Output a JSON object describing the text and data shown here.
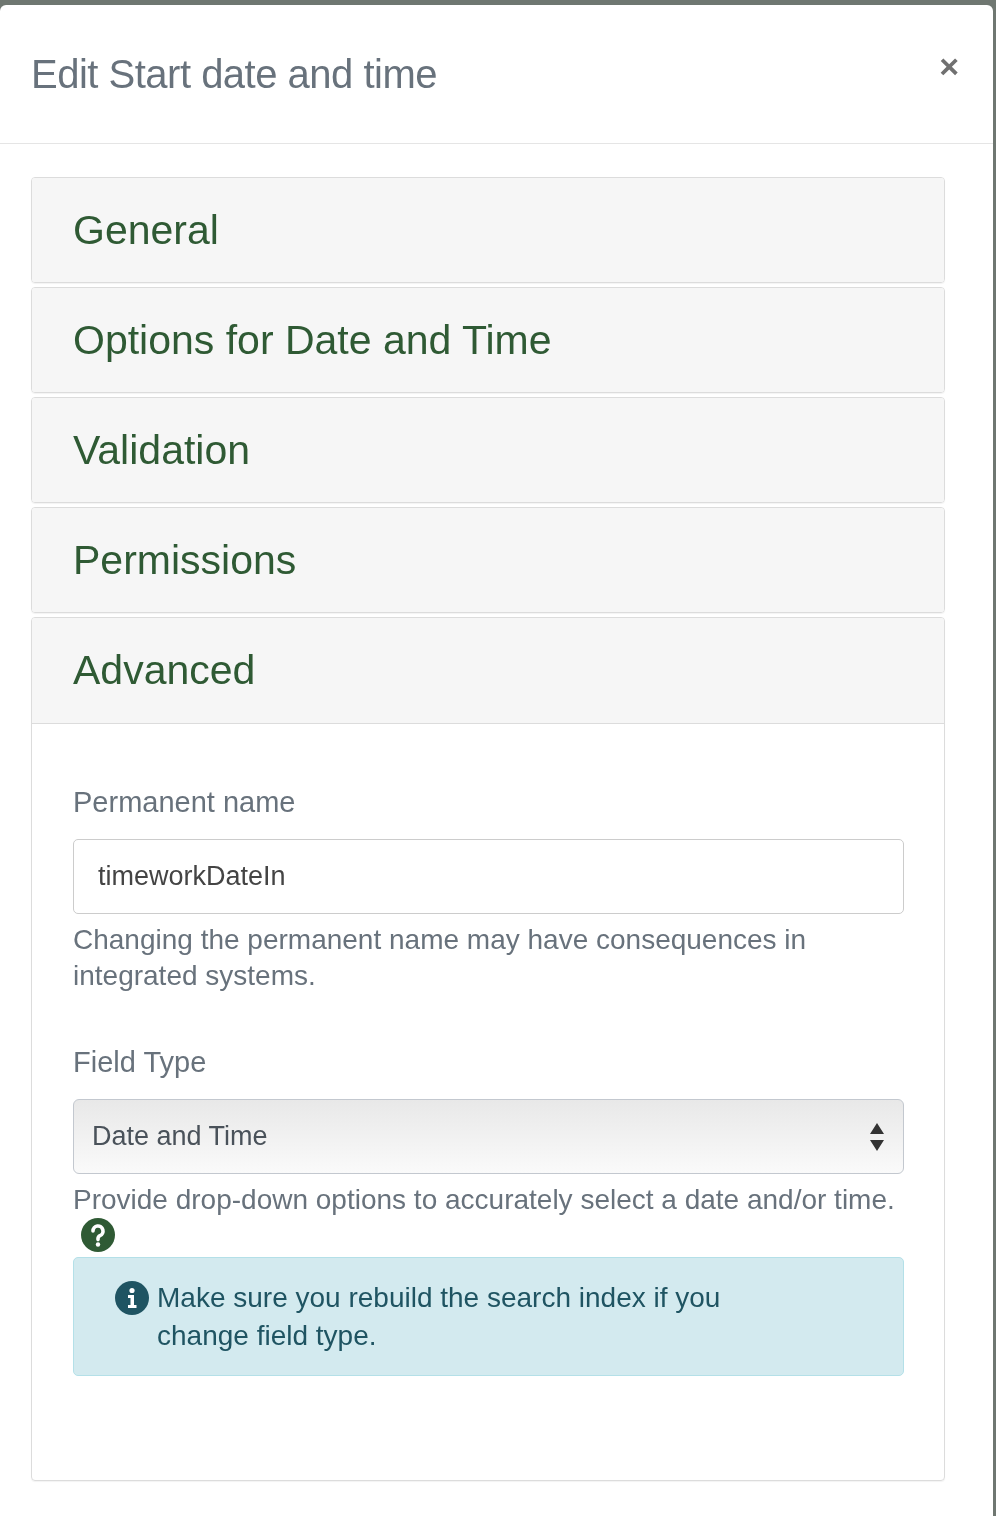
{
  "modal": {
    "title": "Edit Start date and time",
    "close": "×"
  },
  "sections": [
    {
      "title": "General",
      "expanded": false
    },
    {
      "title": "Options for Date and Time",
      "expanded": false
    },
    {
      "title": "Validation",
      "expanded": false
    },
    {
      "title": "Permissions",
      "expanded": false
    },
    {
      "title": "Advanced",
      "expanded": true,
      "fields": [
        {
          "kind": "text",
          "label": "Permanent name",
          "value": "timeworkDateIn",
          "help": "Changing the permanent name may have consequences in integrated systems.",
          "help_icon": false
        },
        {
          "kind": "select",
          "label": "Field Type",
          "value": "Date and Time",
          "help": "Provide drop-down options to accurately select a date and/or time.",
          "help_icon": true
        }
      ],
      "alert": "Make sure you rebuild the search index if you change field type."
    }
  ]
}
